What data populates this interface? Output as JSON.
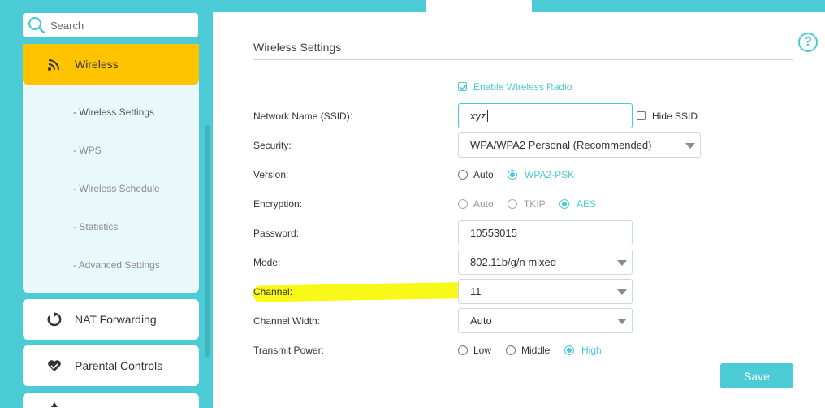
{
  "colors": {
    "accent": "#4acbd6",
    "active_nav": "#ffc400",
    "highlight": "#f7f700"
  },
  "search": {
    "placeholder": "Search"
  },
  "sidebar": {
    "active_section": {
      "label": "Wireless",
      "icon": "wifi-icon"
    },
    "subitems": [
      "- Wireless Settings",
      "- WPS",
      "- Wireless Schedule",
      "- Statistics",
      "- Advanced Settings"
    ],
    "sections": [
      {
        "label": "NAT Forwarding",
        "icon": "nat-forwarding-icon"
      },
      {
        "label": "Parental Controls",
        "icon": "heart-icon"
      }
    ]
  },
  "main": {
    "title": "Wireless Settings",
    "help_icon": "?",
    "enable_radio_label": "Enable Wireless Radio",
    "ssid": {
      "label": "Network Name (SSID):",
      "value": "xyz",
      "hide_label": "Hide SSID"
    },
    "security": {
      "label": "Security:",
      "value": "WPA/WPA2 Personal (Recommended)"
    },
    "version": {
      "label": "Version:",
      "options": [
        "Auto",
        "WPA2-PSK"
      ],
      "selected": "WPA2-PSK"
    },
    "encryption": {
      "label": "Encryption:",
      "options": [
        "Auto",
        "TKIP",
        "AES"
      ],
      "selected": "AES"
    },
    "password": {
      "label": "Password:",
      "value": "10553015"
    },
    "mode": {
      "label": "Mode:",
      "value": "802.11b/g/n mixed"
    },
    "channel": {
      "label": "Channel:",
      "value": "11"
    },
    "channel_width": {
      "label": "Channel Width:",
      "value": "Auto"
    },
    "transmit_power": {
      "label": "Transmit Power:",
      "options": [
        "Low",
        "Middle",
        "High"
      ],
      "selected": "High"
    },
    "save_label": "Save"
  }
}
